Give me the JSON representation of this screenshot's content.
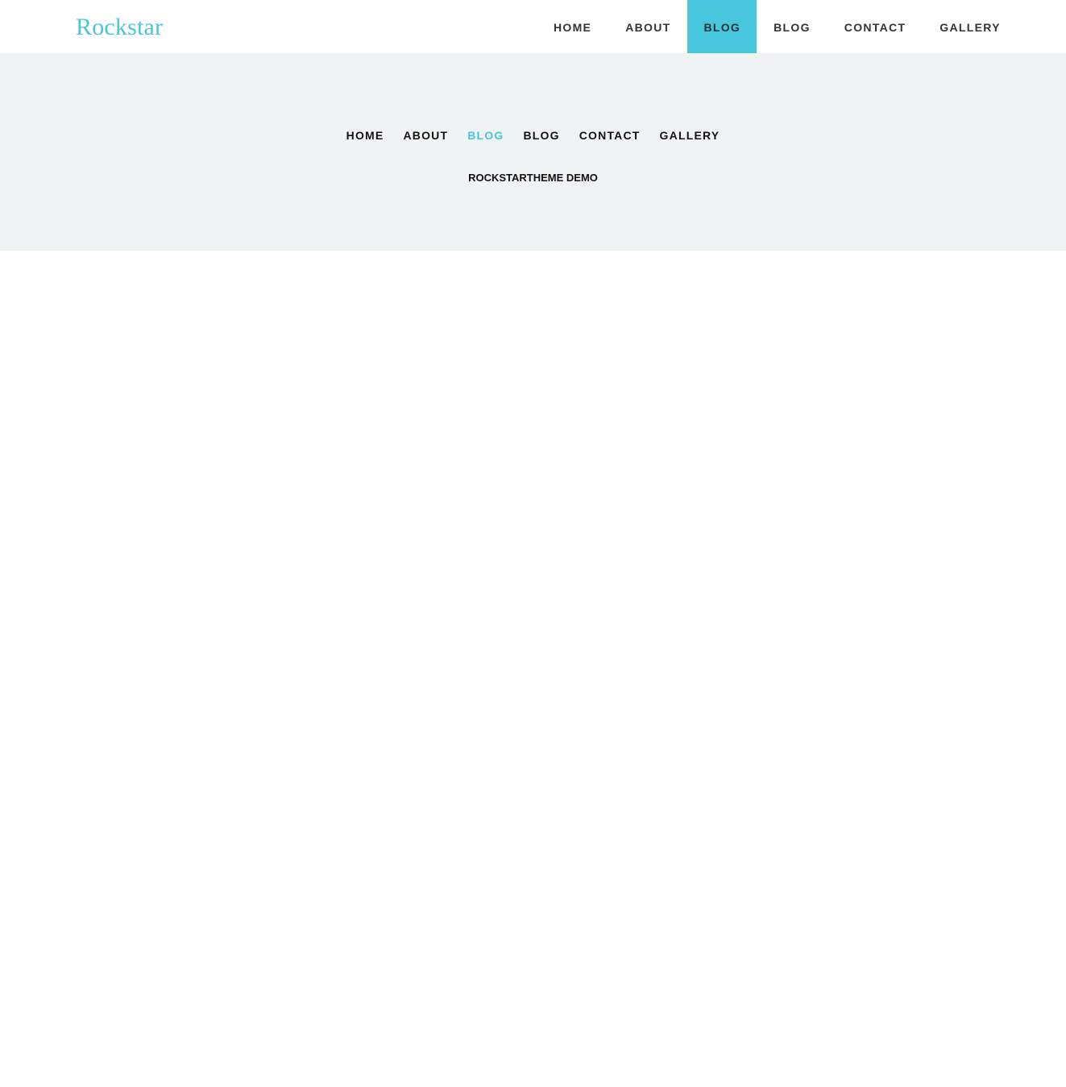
{
  "site": {
    "logo_text": "Rockstar",
    "accent_color": "#47c6dd"
  },
  "header": {
    "nav": [
      {
        "label": "HOME",
        "active": false
      },
      {
        "label": "ABOUT",
        "active": false
      },
      {
        "label": "BLOG",
        "active": true
      },
      {
        "label": "BLOG",
        "active": false
      },
      {
        "label": "CONTACT",
        "active": false
      },
      {
        "label": "GALLERY",
        "active": false
      }
    ]
  },
  "banner": {
    "nav": [
      {
        "label": "HOME",
        "active": false
      },
      {
        "label": "ABOUT",
        "active": false
      },
      {
        "label": "BLOG",
        "active": true
      },
      {
        "label": "BLOG",
        "active": false
      },
      {
        "label": "CONTACT",
        "active": false
      },
      {
        "label": "GALLERY",
        "active": false
      }
    ],
    "title": "ROCKSTARTHEME DEMO"
  }
}
